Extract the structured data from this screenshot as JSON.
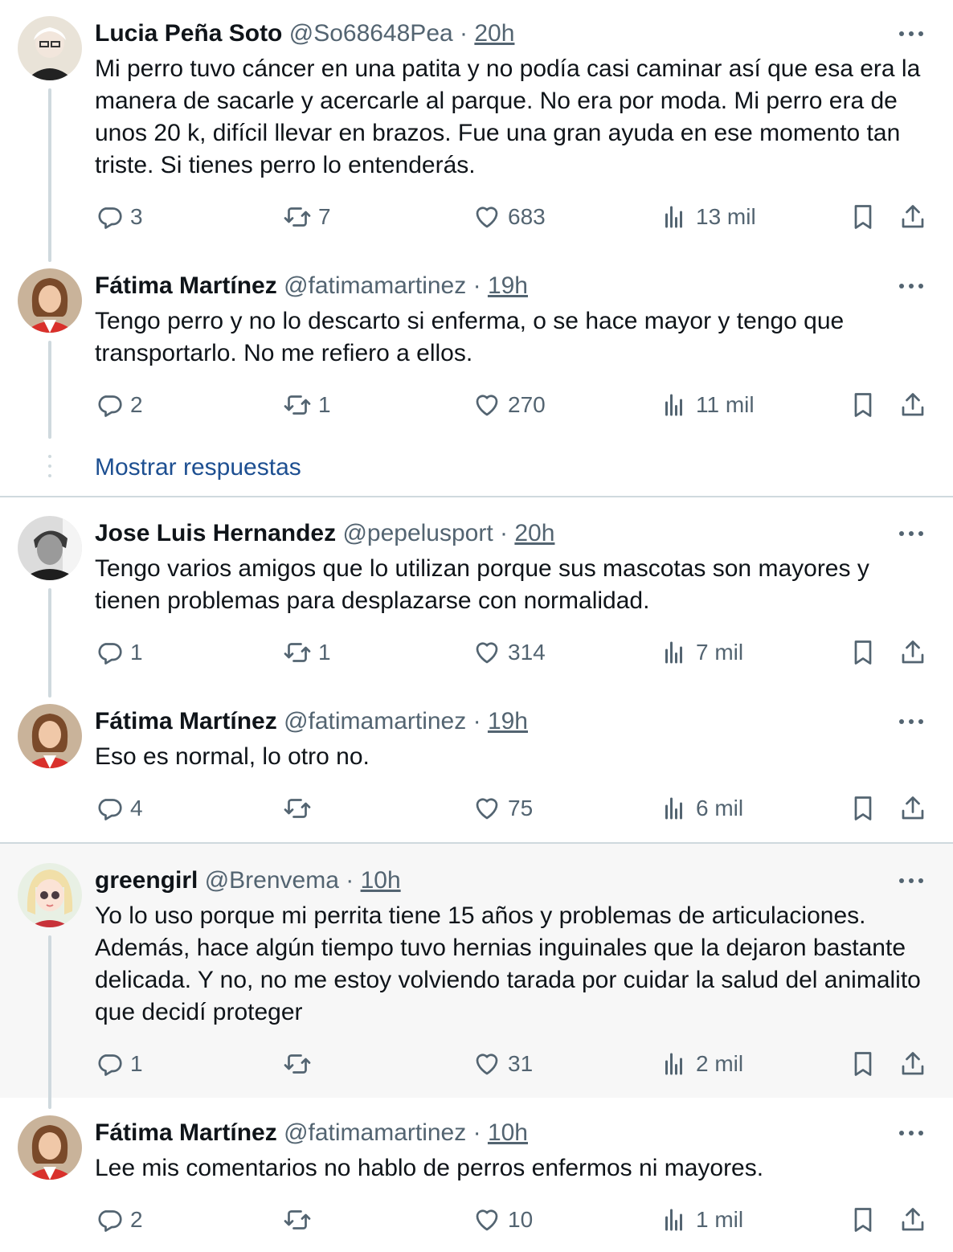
{
  "colors": {
    "text": "#0f1419",
    "muted": "#536471",
    "link": "#1d4f91",
    "line": "#cfd9de",
    "highlight_bg": "#f7f7f7"
  },
  "icons": {
    "reply": "reply-icon",
    "retweet": "retweet-icon",
    "like": "heart-icon",
    "views": "views-icon",
    "bookmark": "bookmark-icon",
    "share": "share-icon",
    "more": "more-icon"
  },
  "tweets": [
    {
      "name": "Lucia Peña Soto",
      "handle": "@So68648Pea",
      "dot": "·",
      "time": "20h",
      "text": "Mi perro tuvo cáncer en una patita y no podía casi caminar así que esa era la manera de sacarle y acercarle al parque. No era por moda. Mi perro era de unos 20 k, difícil llevar en brazos. Fue una gran ayuda en ese momento tan triste. Si tienes perro lo entenderás.",
      "replies": "3",
      "retweets": "7",
      "likes": "683",
      "views": "13 mil"
    },
    {
      "name": "Fátima Martínez",
      "handle": "@fatimamartinez",
      "dot": "·",
      "time": "19h",
      "text": "Tengo perro y no lo descarto si enferma, o se hace mayor y tengo que transportarlo. No me refiero a ellos.",
      "replies": "2",
      "retweets": "1",
      "likes": "270",
      "views": "11 mil"
    },
    {
      "name": "Jose Luis Hernandez",
      "handle": "@pepelusport",
      "dot": "·",
      "time": "20h",
      "text": "Tengo varios amigos que lo utilizan porque sus mascotas son mayores y tienen problemas para desplazarse con normalidad.",
      "replies": "1",
      "retweets": "1",
      "likes": "314",
      "views": "7 mil"
    },
    {
      "name": "Fátima Martínez",
      "handle": "@fatimamartinez",
      "dot": "·",
      "time": "19h",
      "text": "Eso es normal, lo otro no.",
      "replies": "4",
      "retweets": "",
      "likes": "75",
      "views": "6 mil"
    },
    {
      "name": "greengirl",
      "handle": "@Brenvema",
      "dot": "·",
      "time": "10h",
      "text": "Yo lo uso porque mi perrita tiene 15 años y problemas de articulaciones. Además, hace algún tiempo tuvo hernias inguinales que la dejaron bastante delicada. Y no, no me estoy volviendo tarada por cuidar la salud del animalito que decidí proteger",
      "replies": "1",
      "retweets": "",
      "likes": "31",
      "views": "2 mil"
    },
    {
      "name": "Fátima Martínez",
      "handle": "@fatimamartinez",
      "dot": "·",
      "time": "10h",
      "text": "Lee mis comentarios no hablo de perros enfermos ni mayores.",
      "replies": "2",
      "retweets": "",
      "likes": "10",
      "views": "1 mil"
    }
  ],
  "show_replies": "Mostrar respuestas"
}
